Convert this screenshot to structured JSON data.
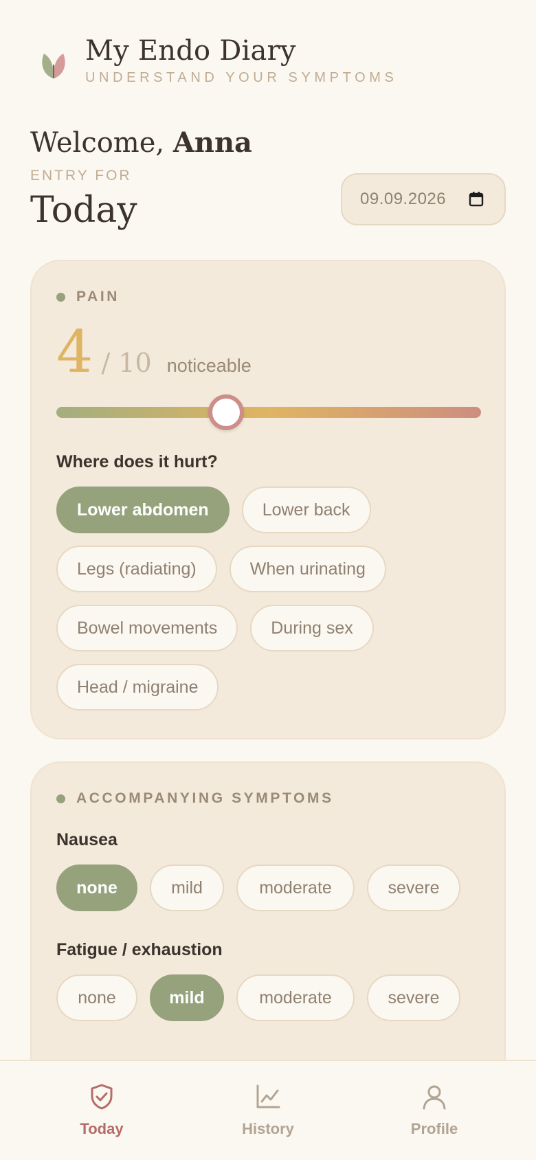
{
  "header": {
    "title": "My Endo Diary",
    "subtitle": "UNDERSTAND YOUR SYMPTOMS",
    "logo_icon": "leaf-logo-icon"
  },
  "welcome": {
    "greeting": "Welcome,",
    "name": "Anna"
  },
  "entry": {
    "label": "ENTRY FOR",
    "day": "Today",
    "date": "09.09.2026",
    "calendar_icon": "calendar-icon"
  },
  "pain": {
    "section_title": "PAIN",
    "value": "4",
    "max": "/ 10",
    "description": "noticeable",
    "slider_fraction": 0.4,
    "question": "Where does it hurt?",
    "locations": [
      {
        "label": "Lower abdomen",
        "selected": true
      },
      {
        "label": "Lower back",
        "selected": false
      },
      {
        "label": "Legs (radiating)",
        "selected": false
      },
      {
        "label": "When urinating",
        "selected": false
      },
      {
        "label": "Bowel movements",
        "selected": false
      },
      {
        "label": "During sex",
        "selected": false
      },
      {
        "label": "Head / migraine",
        "selected": false
      }
    ]
  },
  "symptoms": {
    "section_title": "ACCOMPANYING SYMPTOMS",
    "nausea": {
      "label": "Nausea",
      "options": [
        "none",
        "mild",
        "moderate",
        "severe"
      ],
      "selected": "none"
    },
    "fatigue": {
      "label": "Fatigue / exhaustion",
      "options": [
        "none",
        "mild",
        "moderate",
        "severe"
      ],
      "selected": "mild"
    }
  },
  "nav": {
    "items": [
      {
        "label": "Today",
        "icon": "shield-check-icon",
        "active": true
      },
      {
        "label": "History",
        "icon": "line-chart-icon",
        "active": false
      },
      {
        "label": "Profile",
        "icon": "user-icon",
        "active": false
      }
    ]
  },
  "colors": {
    "accent_green": "#95a27c",
    "accent_rose": "#b56c68",
    "pain_gold": "#dfb462",
    "background": "#fbf7f1",
    "card": "#f3eadc"
  }
}
